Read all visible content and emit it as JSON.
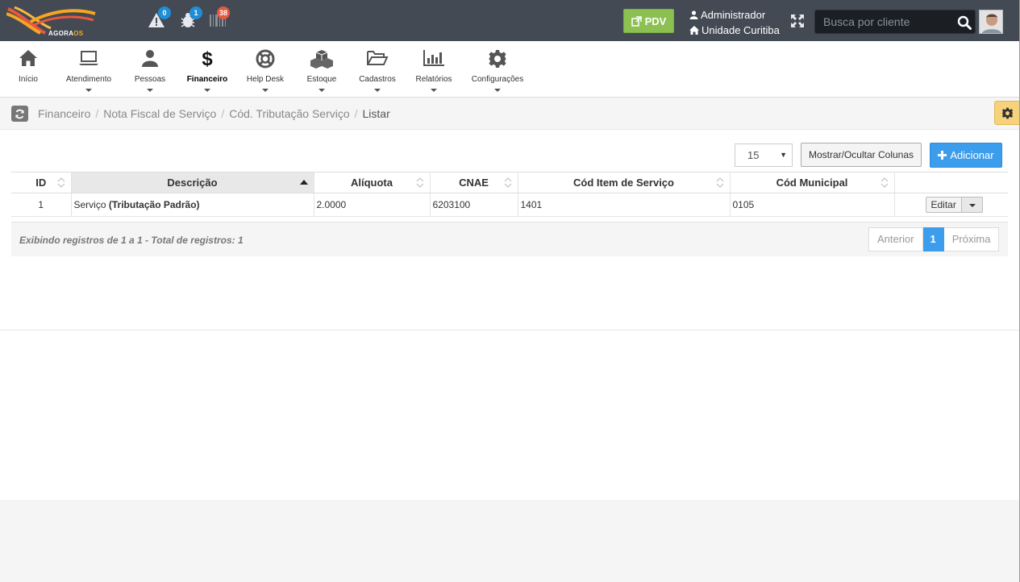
{
  "brand": {
    "logo_text_1": "AGORA",
    "logo_text_2": "OS"
  },
  "header": {
    "notifications": [
      {
        "icon": "warning-icon",
        "count": "0",
        "color": "#1f8ed6"
      },
      {
        "icon": "bug-icon",
        "count": "1",
        "color": "#1f8ed6"
      },
      {
        "icon": "barcode-icon",
        "count": "38",
        "color": "#e9573f"
      }
    ],
    "pdv_label": "PDV",
    "user_name": "Administrador",
    "unit_name": "Unidade Curitiba",
    "search_placeholder": "Busca por cliente"
  },
  "menu": [
    {
      "label": "Início",
      "icon": "home-icon",
      "active": false
    },
    {
      "label": "Atendimento",
      "icon": "laptop-icon",
      "active": false
    },
    {
      "label": "Pessoas",
      "icon": "user-icon",
      "active": false
    },
    {
      "label": "Financeiro",
      "icon": "dollar-icon",
      "active": true
    },
    {
      "label": "Help Desk",
      "icon": "lifebuoy-icon",
      "active": false
    },
    {
      "label": "Estoque",
      "icon": "cubes-icon",
      "active": false
    },
    {
      "label": "Cadastros",
      "icon": "folder-open-icon",
      "active": false
    },
    {
      "label": "Relatórios",
      "icon": "bar-chart-icon",
      "active": false
    },
    {
      "label": "Configurações",
      "icon": "gear-icon",
      "active": false
    }
  ],
  "breadcrumb": [
    "Financeiro",
    "Nota Fiscal de Serviço",
    "Cód. Tributação Serviço",
    "Listar"
  ],
  "toolbar": {
    "page_size": "15",
    "toggle_columns_label": "Mostrar/Ocultar Colunas",
    "add_label": "Adicionar"
  },
  "table": {
    "columns": [
      "ID",
      "Descrição",
      "Alíquota",
      "CNAE",
      "Cód Item de Serviço",
      "Cód Municipal",
      ""
    ],
    "sorted_column": "Descrição",
    "rows": [
      {
        "id": "1",
        "descricao_prefix": "Serviço ",
        "descricao_bold": "(Tributação Padrão)",
        "aliquota": "2.0000",
        "cnae": "6203100",
        "cod_item": "1401",
        "cod_municipal": "0105",
        "action": "Editar"
      }
    ]
  },
  "footer": {
    "summary": "Exibindo registros de 1 a 1 - Total de registros: 1",
    "pager": {
      "prev": "Anterior",
      "current": "1",
      "next": "Próxima"
    }
  },
  "colors": {
    "topbar": "#434a54",
    "pdv": "#8cc152",
    "primary": "#3c9ded",
    "gear": "#f6d27a"
  }
}
